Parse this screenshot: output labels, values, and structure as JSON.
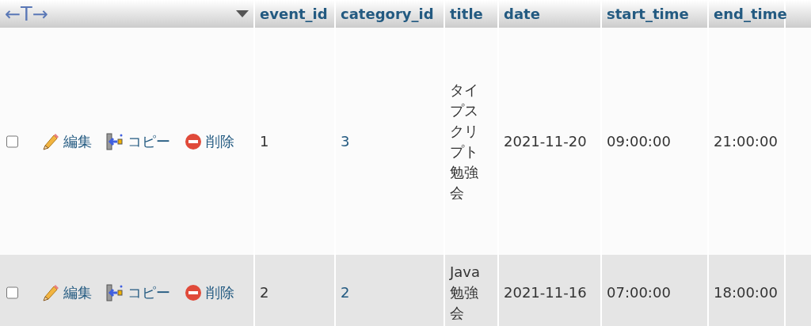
{
  "table": {
    "toolbar_label": "←T→",
    "columns": [
      "event_id",
      "category_id",
      "title",
      "date",
      "start_time",
      "end_time"
    ],
    "rows": [
      {
        "checked": false,
        "actions": {
          "edit": "編集",
          "copy": "コピー",
          "delete": "削除"
        },
        "event_id": "1",
        "category_id": "3",
        "title": "タイプスクリプト勉強会",
        "date": "2021-11-20",
        "start_time": "09:00:00",
        "end_time": "21:00:00"
      },
      {
        "checked": false,
        "actions": {
          "edit": "編集",
          "copy": "コピー",
          "delete": "削除"
        },
        "event_id": "2",
        "category_id": "2",
        "title": "Java勉強会",
        "date": "2021-11-16",
        "start_time": "07:00:00",
        "end_time": "18:00:00"
      }
    ]
  }
}
